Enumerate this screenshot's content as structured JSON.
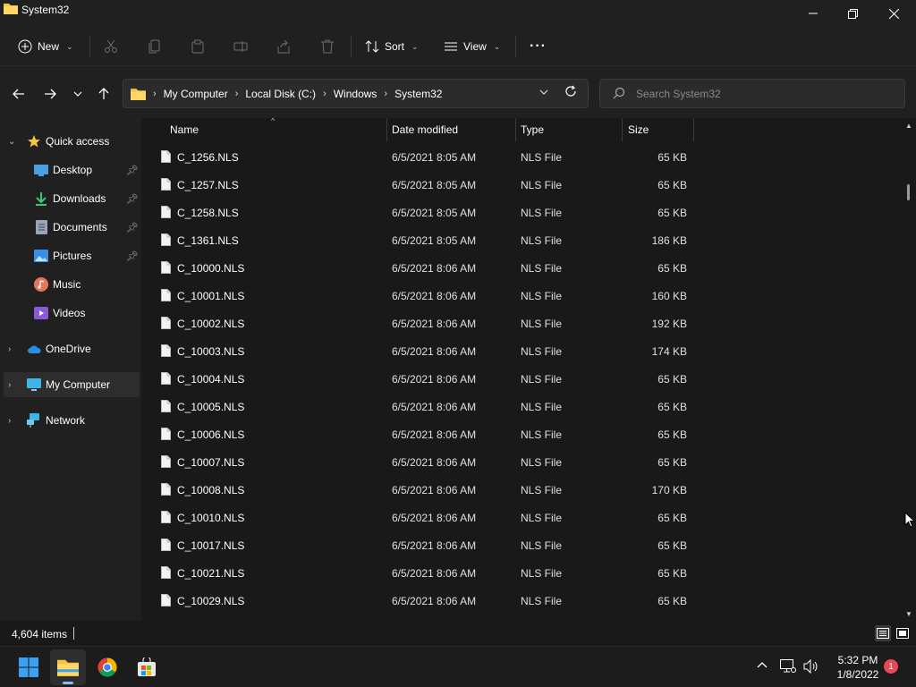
{
  "window": {
    "title": "System32",
    "minimize_icon": "minimize-icon",
    "maximize_icon": "restore-icon",
    "close_icon": "close-icon"
  },
  "commandbar": {
    "new_label": "New",
    "sort_label": "Sort",
    "view_label": "View",
    "more_label": "···"
  },
  "address": {
    "crumbs": [
      "My Computer",
      "Local Disk (C:)",
      "Windows",
      "System32"
    ],
    "search_placeholder": "Search System32"
  },
  "sidebar": {
    "items": [
      {
        "label": "Quick access",
        "icon": "star-icon"
      },
      {
        "label": "Desktop",
        "icon": "desktop-icon"
      },
      {
        "label": "Downloads",
        "icon": "download-icon"
      },
      {
        "label": "Documents",
        "icon": "documents-icon"
      },
      {
        "label": "Pictures",
        "icon": "pictures-icon"
      },
      {
        "label": "Music",
        "icon": "music-icon"
      },
      {
        "label": "Videos",
        "icon": "videos-icon"
      },
      {
        "label": "OneDrive",
        "icon": "cloud-icon"
      },
      {
        "label": "My Computer",
        "icon": "computer-icon"
      },
      {
        "label": "Network",
        "icon": "network-icon"
      }
    ]
  },
  "columns": {
    "name": "Name",
    "date": "Date modified",
    "type": "Type",
    "size": "Size"
  },
  "files": [
    {
      "name": "C_1256.NLS",
      "date": "6/5/2021 8:05 AM",
      "type": "NLS File",
      "size": "65 KB"
    },
    {
      "name": "C_1257.NLS",
      "date": "6/5/2021 8:05 AM",
      "type": "NLS File",
      "size": "65 KB"
    },
    {
      "name": "C_1258.NLS",
      "date": "6/5/2021 8:05 AM",
      "type": "NLS File",
      "size": "65 KB"
    },
    {
      "name": "C_1361.NLS",
      "date": "6/5/2021 8:05 AM",
      "type": "NLS File",
      "size": "186 KB"
    },
    {
      "name": "C_10000.NLS",
      "date": "6/5/2021 8:06 AM",
      "type": "NLS File",
      "size": "65 KB"
    },
    {
      "name": "C_10001.NLS",
      "date": "6/5/2021 8:06 AM",
      "type": "NLS File",
      "size": "160 KB"
    },
    {
      "name": "C_10002.NLS",
      "date": "6/5/2021 8:06 AM",
      "type": "NLS File",
      "size": "192 KB"
    },
    {
      "name": "C_10003.NLS",
      "date": "6/5/2021 8:06 AM",
      "type": "NLS File",
      "size": "174 KB"
    },
    {
      "name": "C_10004.NLS",
      "date": "6/5/2021 8:06 AM",
      "type": "NLS File",
      "size": "65 KB"
    },
    {
      "name": "C_10005.NLS",
      "date": "6/5/2021 8:06 AM",
      "type": "NLS File",
      "size": "65 KB"
    },
    {
      "name": "C_10006.NLS",
      "date": "6/5/2021 8:06 AM",
      "type": "NLS File",
      "size": "65 KB"
    },
    {
      "name": "C_10007.NLS",
      "date": "6/5/2021 8:06 AM",
      "type": "NLS File",
      "size": "65 KB"
    },
    {
      "name": "C_10008.NLS",
      "date": "6/5/2021 8:06 AM",
      "type": "NLS File",
      "size": "170 KB"
    },
    {
      "name": "C_10010.NLS",
      "date": "6/5/2021 8:06 AM",
      "type": "NLS File",
      "size": "65 KB"
    },
    {
      "name": "C_10017.NLS",
      "date": "6/5/2021 8:06 AM",
      "type": "NLS File",
      "size": "65 KB"
    },
    {
      "name": "C_10021.NLS",
      "date": "6/5/2021 8:06 AM",
      "type": "NLS File",
      "size": "65 KB"
    },
    {
      "name": "C_10029.NLS",
      "date": "6/5/2021 8:06 AM",
      "type": "NLS File",
      "size": "65 KB"
    }
  ],
  "status": {
    "items_text": "4,604 items"
  },
  "taskbar": {
    "apps": [
      "start-icon",
      "file-explorer-icon",
      "chrome-icon",
      "store-icon"
    ],
    "time": "5:32 PM",
    "date": "1/8/2022",
    "notification_count": "1"
  },
  "colors": {
    "background": "#191919",
    "chrome": "#202020",
    "accent": "#60cdff",
    "folder": "#f4c443"
  }
}
